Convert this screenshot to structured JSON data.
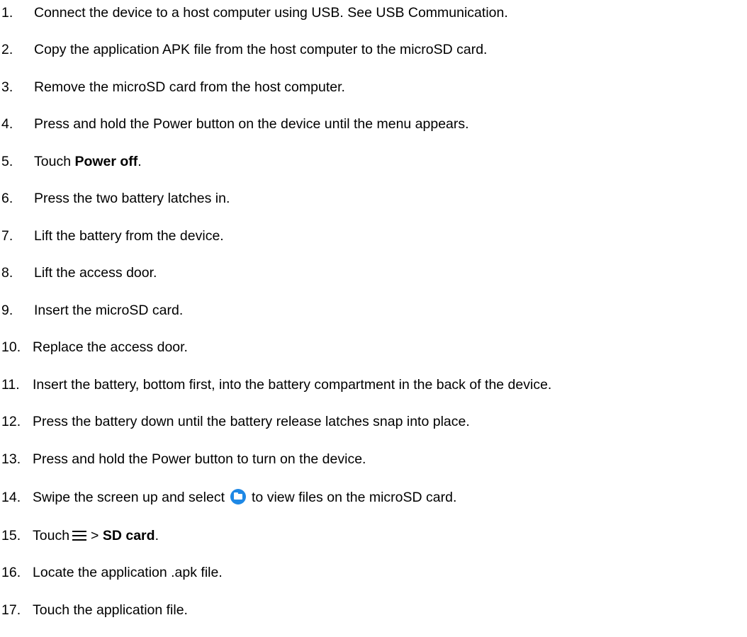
{
  "steps": [
    {
      "n": "1.",
      "text": "Connect the device to a host computer using USB. See USB Communication."
    },
    {
      "n": "2.",
      "text": "Copy the application APK file from the host computer to the microSD card."
    },
    {
      "n": "3.",
      "text": "Remove the microSD card from the host computer."
    },
    {
      "n": "4.",
      "text": "Press and hold the Power button on the device until the menu appears."
    },
    {
      "n": "5.",
      "pre": "Touch ",
      "bold": "Power off",
      "post": "."
    },
    {
      "n": "6.",
      "text": "Press the two battery latches in."
    },
    {
      "n": "7.",
      "text": "Lift the battery from the device."
    },
    {
      "n": "8.",
      "text": "Lift the access door."
    },
    {
      "n": "9.",
      "text": "Insert the microSD card."
    },
    {
      "n": "10.",
      "text": "Replace the access door."
    },
    {
      "n": "11.",
      "text": "Insert the battery, bottom first, into the battery compartment in the back of the device."
    },
    {
      "n": "12.",
      "text": "Press the battery down until the battery release latches snap into place."
    },
    {
      "n": "13.",
      "text": "Press and hold the Power button to turn on the device."
    },
    {
      "n": "14.",
      "pre": "Swipe the screen up and select",
      "icon": "folder-icon",
      "post": "to view files on the microSD card."
    },
    {
      "n": "15.",
      "pre": "Touch",
      "icon": "menu-icon",
      "sep": "> ",
      "bold": "SD card",
      "post": "."
    },
    {
      "n": "16.",
      "text": "Locate the application .apk file."
    },
    {
      "n": "17.",
      "text": "Touch the application file."
    }
  ],
  "colors": {
    "text": "#000000",
    "folder_icon": "#1e88e5"
  }
}
